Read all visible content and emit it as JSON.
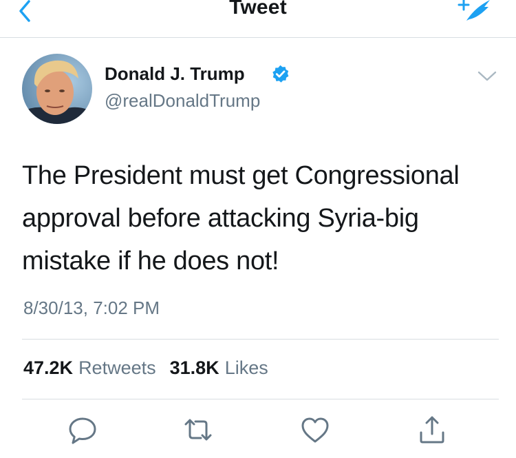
{
  "nav": {
    "title": "Tweet"
  },
  "author": {
    "name": "Donald J. Trump",
    "handle": "@realDonaldTrump"
  },
  "tweet": {
    "text": "The President must get Congressional approval before attacking Syria-big mistake if he does not!",
    "timestamp": "8/30/13, 7:02 PM"
  },
  "stats": {
    "retweets_count": "47.2K",
    "retweets_label": "Retweets",
    "likes_count": "31.8K",
    "likes_label": "Likes"
  },
  "icons": {
    "back": "chevron-left-icon",
    "compose": "compose-tweet-icon",
    "verified": "verified-badge-icon",
    "more": "chevron-down-icon",
    "reply": "reply-icon",
    "retweet": "retweet-icon",
    "like": "heart-icon",
    "share": "share-icon"
  },
  "colors": {
    "accent": "#1da1f2",
    "text": "#14171a",
    "secondary_text": "#657786",
    "divider": "#d8dde1",
    "icon_gray": "#657786"
  }
}
